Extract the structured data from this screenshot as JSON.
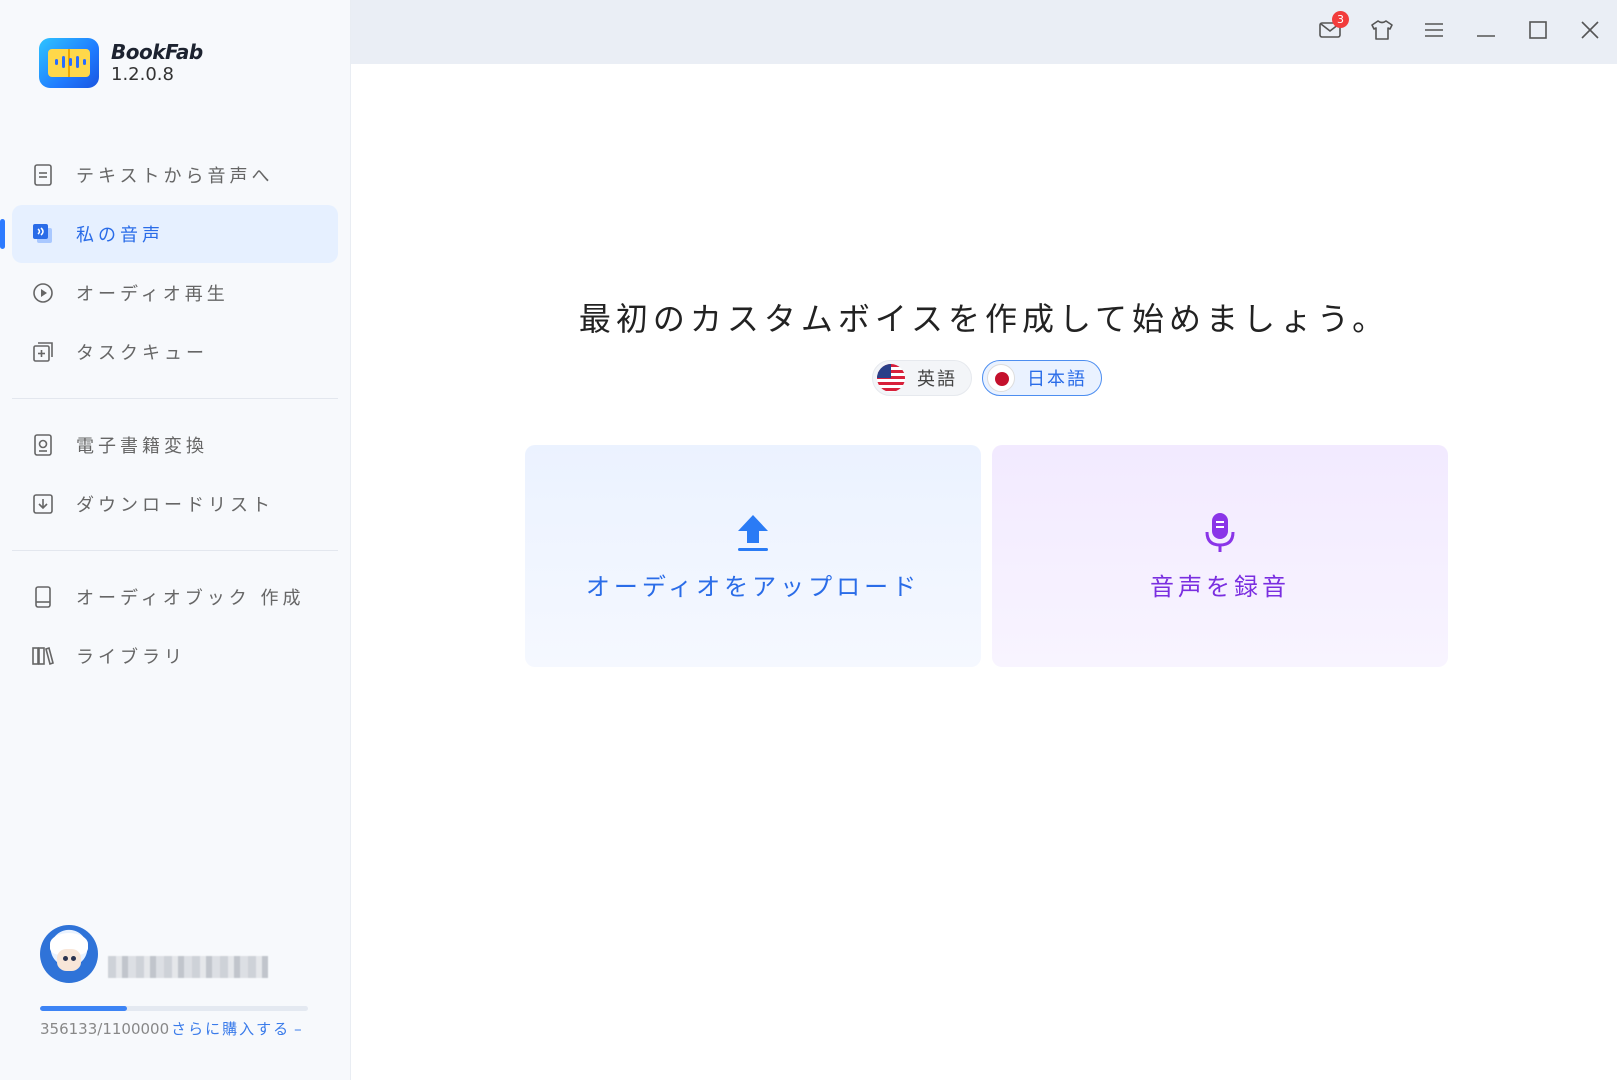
{
  "app": {
    "name": "BookFab",
    "version": "1.2.0.8"
  },
  "titlebar": {
    "mail_badge": "3",
    "icons": [
      "mail-icon",
      "shirt-icon",
      "menu-icon",
      "minimize-icon",
      "maximize-icon",
      "close-icon"
    ]
  },
  "sidebar": {
    "groups": [
      [
        {
          "label": "テキストから音声へ",
          "icon": "document-icon"
        },
        {
          "label": "私の音声",
          "icon": "voice-card-icon",
          "active": true
        },
        {
          "label": "オーディオ再生",
          "icon": "play-circle-icon"
        },
        {
          "label": "タスクキュー",
          "icon": "queue-icon"
        }
      ],
      [
        {
          "label": "電子書籍変換",
          "icon": "ebook-icon"
        },
        {
          "label": "ダウンロードリスト",
          "icon": "download-icon"
        }
      ],
      [
        {
          "label": "オーディオブック 作成",
          "icon": "book-icon"
        },
        {
          "label": "ライブラリ",
          "icon": "library-icon"
        }
      ]
    ],
    "quota": {
      "text": "356133/1100000",
      "used": 356133,
      "total": 1100000,
      "buy_label": "さらに購入する",
      "buy_arrow": "–"
    }
  },
  "main": {
    "headline": "最初のカスタムボイスを作成して始めましょう。",
    "languages": [
      {
        "label": "英語",
        "flag": "us-flag-icon",
        "active": false
      },
      {
        "label": "日本語",
        "flag": "jp-flag-icon",
        "active": true
      }
    ],
    "upload_label": "オーディオをアップロード",
    "record_label": "音声を録音"
  },
  "colors": {
    "accent": "#2a6ce8",
    "record": "#7a2ee0",
    "badge": "#f23c3c"
  }
}
